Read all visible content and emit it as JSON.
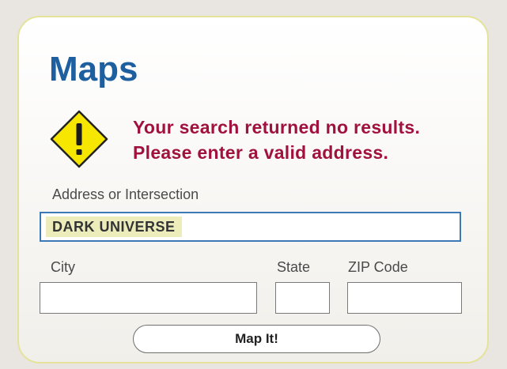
{
  "header": {
    "title": "Maps"
  },
  "alert": {
    "icon": "warning-icon",
    "line1": "Your search returned no results.",
    "line2": "Please enter a valid address.",
    "color": "#a0123d"
  },
  "form": {
    "address": {
      "label": "Address or Intersection",
      "value": "DARK UNIVERSE"
    },
    "city": {
      "label": "City",
      "value": ""
    },
    "state": {
      "label": "State",
      "value": ""
    },
    "zip": {
      "label": "ZIP Code",
      "value": ""
    },
    "submit_label": "Map It!"
  },
  "colors": {
    "title": "#1e5fa0",
    "input_focus_border": "#3d79b5",
    "highlight": "#ecedbb",
    "panel_border": "#e5e29a"
  }
}
